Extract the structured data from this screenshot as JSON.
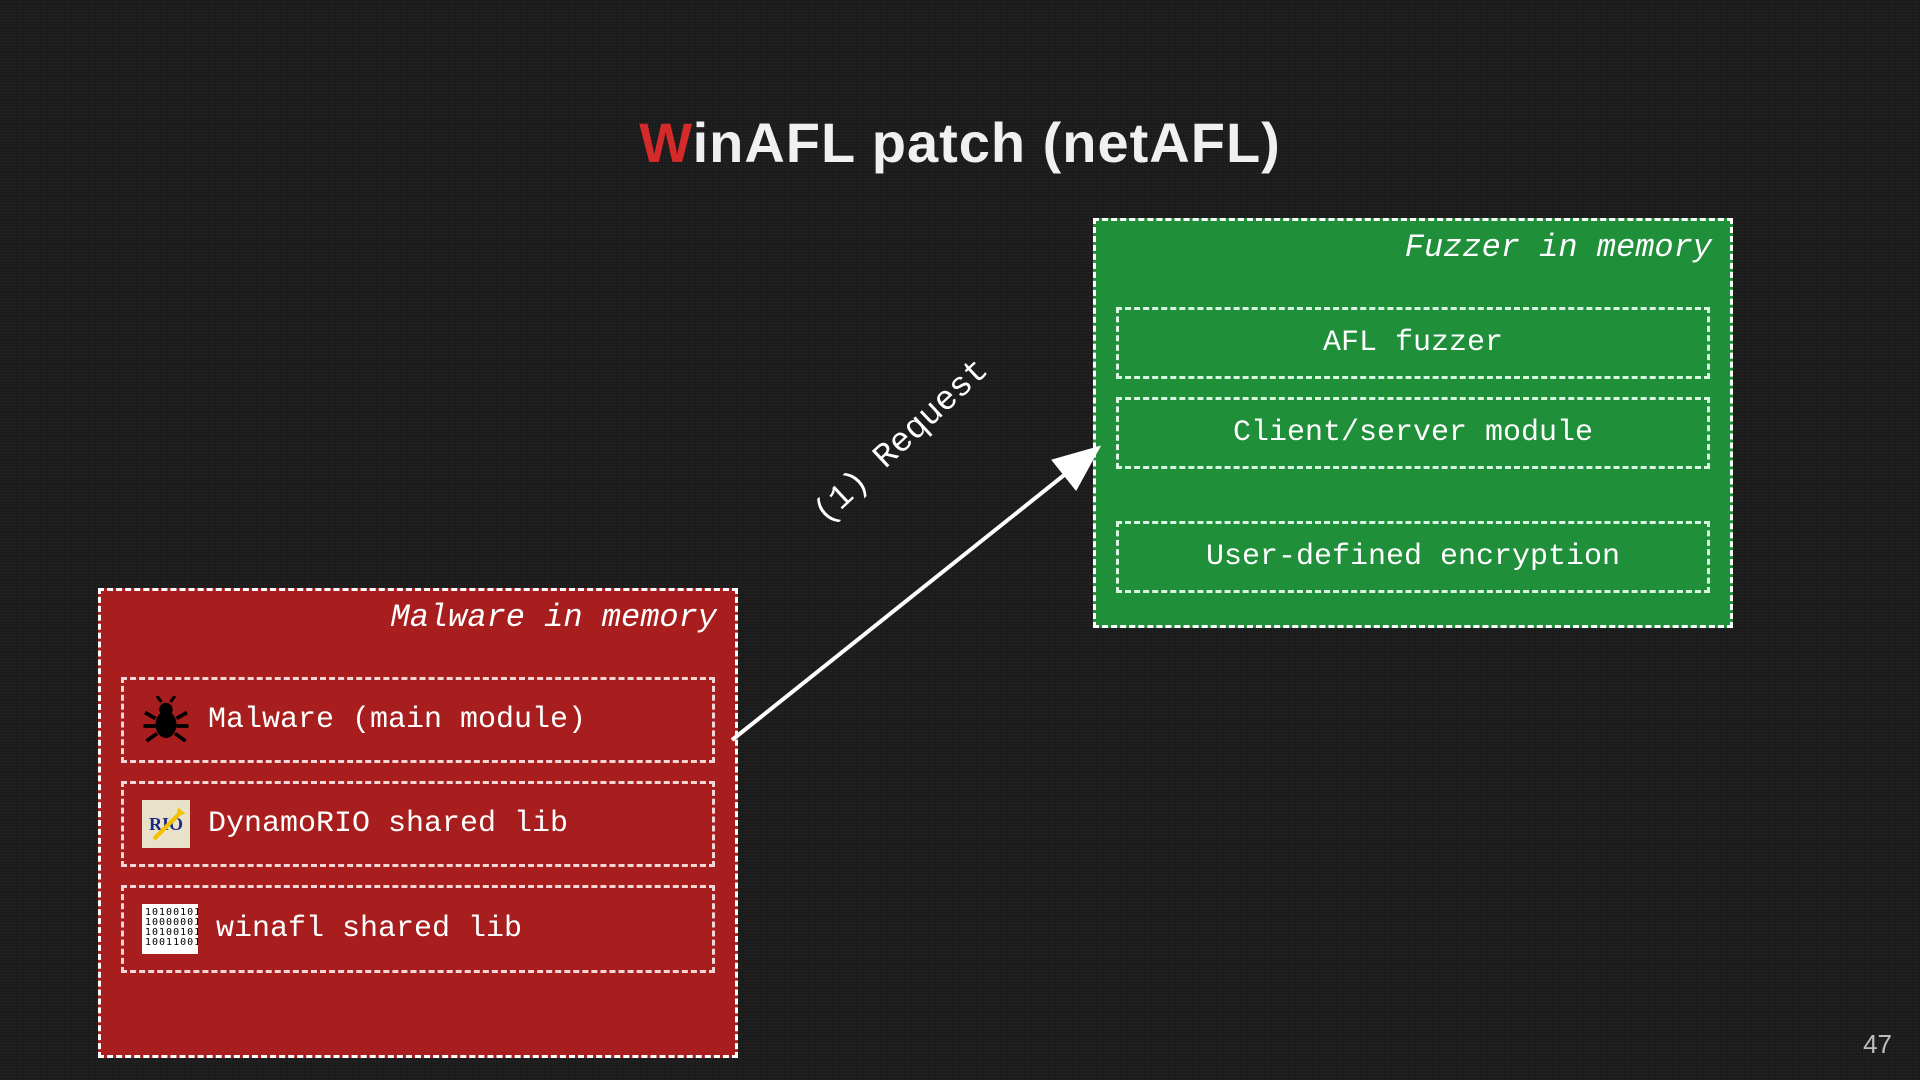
{
  "title": {
    "first": "W",
    "rest": "inAFL patch (netAFL)"
  },
  "fuzzer": {
    "heading": "Fuzzer in memory",
    "items": [
      "AFL fuzzer",
      "Client/server module",
      "User-defined encryption"
    ]
  },
  "malware": {
    "heading": "Malware in memory",
    "items": [
      "Malware (main module)",
      "DynamoRIO shared lib",
      "winafl shared lib"
    ]
  },
  "arrow_label": "(1) Request",
  "page_number": "47",
  "colors": {
    "red": "#a81e1e",
    "green": "#1f8f3a",
    "accent_red": "#d62a2a"
  }
}
